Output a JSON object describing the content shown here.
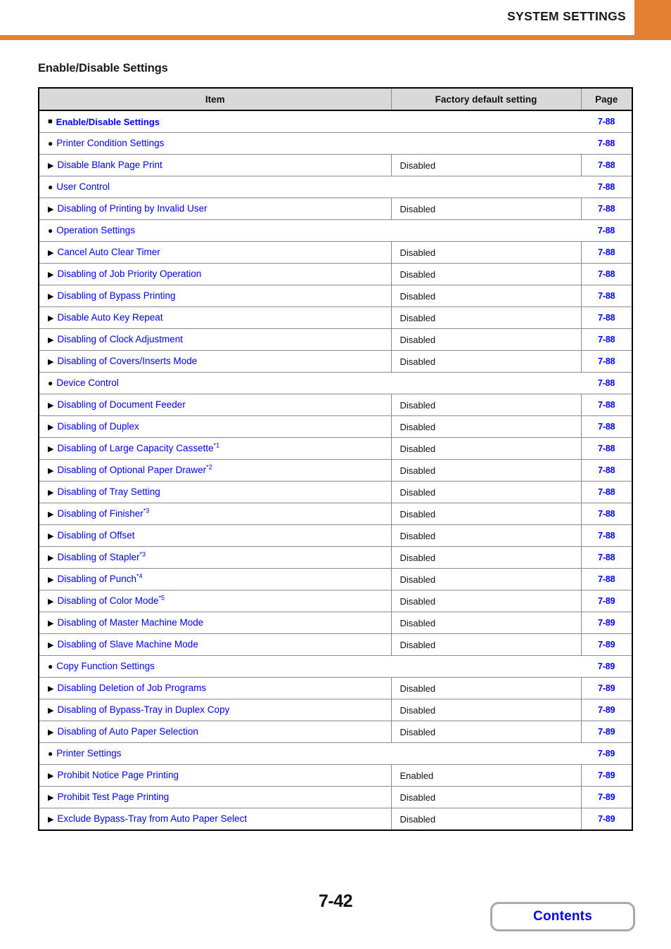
{
  "header": {
    "title": "SYSTEM SETTINGS",
    "accent_color": "#e58033"
  },
  "section": {
    "title": "Enable/Disable Settings"
  },
  "table": {
    "columns": {
      "item": "Item",
      "default": "Factory default setting",
      "page": "Page"
    },
    "link_color": "#0000ff",
    "rows": [
      {
        "level": "section",
        "marker": "square-marker",
        "label": "Enable/Disable Settings",
        "default": "",
        "page": "7-88"
      },
      {
        "level": "group",
        "marker": "circle-marker",
        "label": "Printer Condition Settings",
        "default": "",
        "page": "7-88"
      },
      {
        "level": "leaf",
        "marker": "triangle-marker",
        "label": "Disable Blank Page Print",
        "default": "Disabled",
        "page": "7-88"
      },
      {
        "level": "group",
        "marker": "circle-marker",
        "label": "User Control",
        "default": "",
        "page": "7-88"
      },
      {
        "level": "leaf",
        "marker": "triangle-marker",
        "label": "Disabling of Printing by Invalid User",
        "default": "Disabled",
        "page": "7-88"
      },
      {
        "level": "group",
        "marker": "circle-marker",
        "label": "Operation Settings",
        "default": "",
        "page": "7-88"
      },
      {
        "level": "leaf",
        "marker": "triangle-marker",
        "label": "Cancel Auto Clear Timer",
        "default": "Disabled",
        "page": "7-88"
      },
      {
        "level": "leaf",
        "marker": "triangle-marker",
        "label": "Disabling of Job Priority Operation",
        "default": "Disabled",
        "page": "7-88"
      },
      {
        "level": "leaf",
        "marker": "triangle-marker",
        "label": "Disabling of Bypass Printing",
        "default": "Disabled",
        "page": "7-88"
      },
      {
        "level": "leaf",
        "marker": "triangle-marker",
        "label": "Disable Auto Key Repeat",
        "default": "Disabled",
        "page": "7-88"
      },
      {
        "level": "leaf",
        "marker": "triangle-marker",
        "label": "Disabling of Clock Adjustment",
        "default": "Disabled",
        "page": "7-88"
      },
      {
        "level": "leaf",
        "marker": "triangle-marker",
        "label": "Disabling of Covers/Inserts Mode",
        "default": "Disabled",
        "page": "7-88"
      },
      {
        "level": "group",
        "marker": "circle-marker",
        "label": "Device Control",
        "default": "",
        "page": "7-88"
      },
      {
        "level": "leaf",
        "marker": "triangle-marker",
        "label": "Disabling of Document Feeder",
        "default": "Disabled",
        "page": "7-88"
      },
      {
        "level": "leaf",
        "marker": "triangle-marker",
        "label": "Disabling of Duplex",
        "default": "Disabled",
        "page": "7-88"
      },
      {
        "level": "leaf",
        "marker": "triangle-marker",
        "label": "Disabling of Large Capacity Cassette",
        "footnote": "*1",
        "default": "Disabled",
        "page": "7-88"
      },
      {
        "level": "leaf",
        "marker": "triangle-marker",
        "label": "Disabling of Optional Paper Drawer",
        "footnote": "*2",
        "default": "Disabled",
        "page": "7-88"
      },
      {
        "level": "leaf",
        "marker": "triangle-marker",
        "label": "Disabling of Tray Setting",
        "default": "Disabled",
        "page": "7-88"
      },
      {
        "level": "leaf",
        "marker": "triangle-marker",
        "label": "Disabling of Finisher",
        "footnote": "*3",
        "default": "Disabled",
        "page": "7-88"
      },
      {
        "level": "leaf",
        "marker": "triangle-marker",
        "label": "Disabling of Offset",
        "default": "Disabled",
        "page": "7-88"
      },
      {
        "level": "leaf",
        "marker": "triangle-marker",
        "label": "Disabling of Stapler",
        "footnote": "*3",
        "default": "Disabled",
        "page": "7-88"
      },
      {
        "level": "leaf",
        "marker": "triangle-marker",
        "label": "Disabling of Punch",
        "footnote": "*4",
        "default": "Disabled",
        "page": "7-88"
      },
      {
        "level": "leaf",
        "marker": "triangle-marker",
        "label": "Disabling of Color Mode",
        "footnote": "*5",
        "default": "Disabled",
        "page": "7-89"
      },
      {
        "level": "leaf",
        "marker": "triangle-marker",
        "label": "Disabling of Master Machine Mode",
        "default": "Disabled",
        "page": "7-89"
      },
      {
        "level": "leaf",
        "marker": "triangle-marker",
        "label": "Disabling of Slave Machine Mode",
        "default": "Disabled",
        "page": "7-89"
      },
      {
        "level": "group",
        "marker": "circle-marker",
        "label": "Copy Function Settings",
        "default": "",
        "page": "7-89"
      },
      {
        "level": "leaf",
        "marker": "triangle-marker",
        "label": "Disabling Deletion of Job Programs",
        "default": "Disabled",
        "page": "7-89"
      },
      {
        "level": "leaf",
        "marker": "triangle-marker",
        "label": "Disabling of Bypass-Tray in Duplex Copy",
        "default": "Disabled",
        "page": "7-89"
      },
      {
        "level": "leaf",
        "marker": "triangle-marker",
        "label": "Disabling of Auto Paper Selection",
        "default": "Disabled",
        "page": "7-89"
      },
      {
        "level": "group",
        "marker": "circle-marker",
        "label": "Printer Settings",
        "default": "",
        "page": "7-89"
      },
      {
        "level": "leaf",
        "marker": "triangle-marker",
        "label": "Prohibit Notice Page Printing",
        "default": "Enabled",
        "page": "7-89"
      },
      {
        "level": "leaf",
        "marker": "triangle-marker",
        "label": "Prohibit Test Page Printing",
        "default": "Disabled",
        "page": "7-89"
      },
      {
        "level": "leaf",
        "marker": "triangle-marker",
        "label": "Exclude Bypass-Tray from Auto Paper Select",
        "default": "Disabled",
        "page": "7-89"
      }
    ]
  },
  "footer": {
    "page_number": "7-42",
    "contents_label": "Contents"
  }
}
